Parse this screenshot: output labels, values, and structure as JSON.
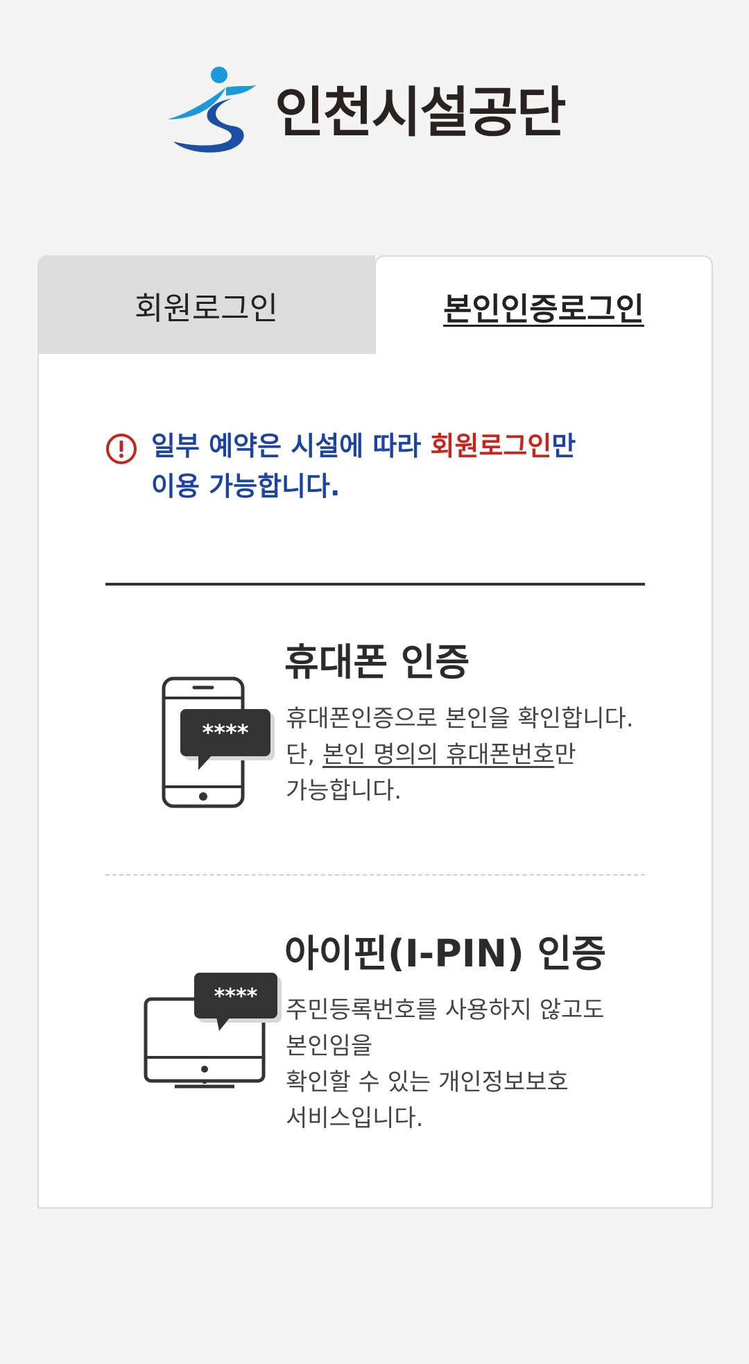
{
  "header": {
    "logo_text": "인천시설공단"
  },
  "tabs": [
    {
      "label": "회원로그인",
      "active": false
    },
    {
      "label": "본인인증로그인",
      "active": true
    }
  ],
  "notice": {
    "prefix": "일부 예약은 시설에 따라 ",
    "highlight": "회원로그인",
    "suffix_line1": "만",
    "line2": "이용 가능합니다."
  },
  "options": {
    "phone": {
      "title": "휴대폰 인증",
      "icon": "smartphone-password-icon",
      "icon_text": "****",
      "desc_line1": "휴대폰인증으로 본인을 확인합니다.",
      "desc_line2_prefix": "단, ",
      "desc_line2_underlined": "본인 명의의 휴대폰번호",
      "desc_line2_suffix": "만",
      "desc_line3": "가능합니다."
    },
    "ipin": {
      "title": "아이핀(I-PIN) 인증",
      "icon": "monitor-password-icon",
      "icon_text": "****",
      "desc_line1": "주민등록번호를 사용하지 않고도",
      "desc_line2": "본인임을",
      "desc_line3": "확인할 수 있는 개인정보보호",
      "desc_line4": "서비스입니다."
    }
  },
  "colors": {
    "notice_blue": "#1b43a4",
    "notice_red": "#c8231c",
    "tab_inactive_bg": "#dcdcdc",
    "page_bg": "#f4f4f4"
  }
}
